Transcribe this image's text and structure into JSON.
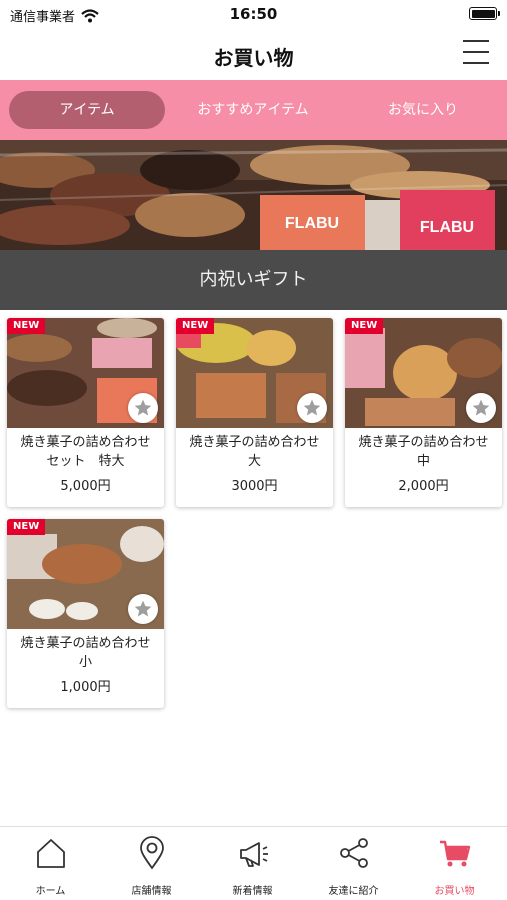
{
  "status_bar": {
    "carrier": "通信事業者",
    "time": "16:50"
  },
  "header": {
    "title": "お買い物"
  },
  "tabs": [
    {
      "label": "アイテム",
      "active": true
    },
    {
      "label": "おすすめアイテム",
      "active": false
    },
    {
      "label": "お気に入り",
      "active": false
    }
  ],
  "banner": {
    "labels": [
      "FLABU",
      "FLABU"
    ]
  },
  "category": {
    "title": "内祝いギフト"
  },
  "products": [
    {
      "badge": "NEW",
      "name": "焼き菓子の詰め合わせ\nセット　特大",
      "price": "5,000円"
    },
    {
      "badge": "NEW",
      "name": "焼き菓子の詰め合わせ\n大",
      "price": "3000円"
    },
    {
      "badge": "NEW",
      "name": "焼き菓子の詰め合わせ\n中",
      "price": "2,000円"
    },
    {
      "badge": "NEW",
      "name": "焼き菓子の詰め合わせ\n小",
      "price": "1,000円"
    }
  ],
  "bottom_nav": [
    {
      "label": "ホーム",
      "icon": "home-icon",
      "active": false
    },
    {
      "label": "店舗情報",
      "icon": "map-pin-icon",
      "active": false
    },
    {
      "label": "新着情報",
      "icon": "megaphone-icon",
      "active": false
    },
    {
      "label": "友達に紹介",
      "icon": "share-icon",
      "active": false
    },
    {
      "label": "お買い物",
      "icon": "cart-icon",
      "active": true
    }
  ],
  "colors": {
    "tab_bar": "#f58ea6",
    "tab_active": "#b45f70",
    "category_bar": "#4b4b4b",
    "badge": "#e3002d",
    "nav_active": "#e84b64"
  }
}
